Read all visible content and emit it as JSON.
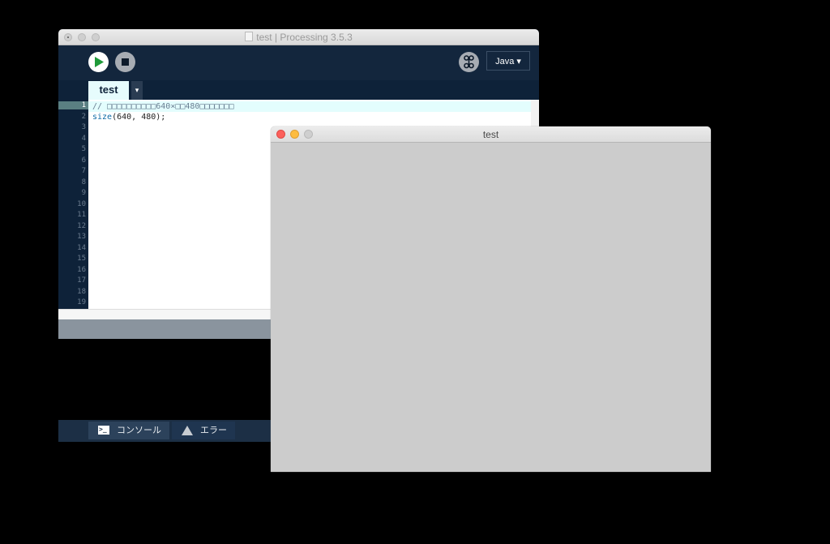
{
  "ide": {
    "title": "test | Processing 3.5.3",
    "mode": "Java ▾",
    "tab_label": "test",
    "tab_menu": "▾",
    "code_lines": [
      "// □□□□□□□□□□640×□□480□□□□□□□",
      "size(640, 480);"
    ],
    "line_numbers": [
      "1",
      "2",
      "3",
      "4",
      "5",
      "6",
      "7",
      "8",
      "9",
      "10",
      "11",
      "12",
      "13",
      "14",
      "15",
      "16",
      "17",
      "18",
      "19"
    ],
    "footer": {
      "console_label": "コンソール",
      "error_label": "エラー"
    }
  },
  "sketch": {
    "title": "test",
    "background_color": "#cccccc"
  },
  "colors": {
    "ide_bg": "#0e2239",
    "run_icon": "#1f9a3a",
    "tab_active": "#e6fcfc"
  },
  "icons": [
    "file-icon",
    "run-icon",
    "stop-icon",
    "debug-icon",
    "chevron-down-icon",
    "console-icon",
    "warning-icon"
  ]
}
